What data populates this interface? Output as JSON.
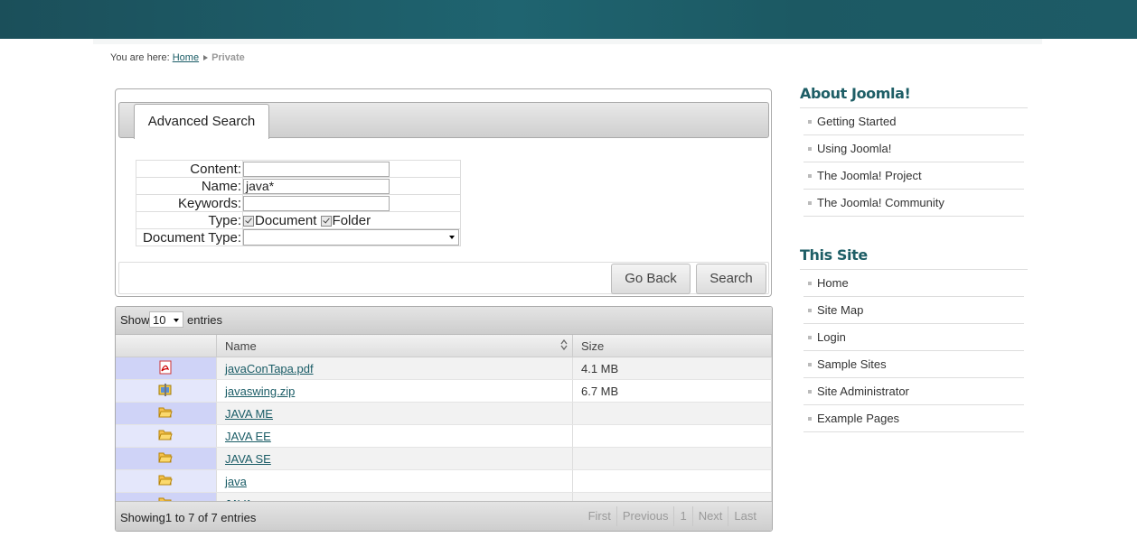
{
  "breadcrumb": {
    "prefix": "You are here:",
    "home": "Home",
    "current": "Private"
  },
  "search": {
    "tab_label": "Advanced Search",
    "content_label": "Content:",
    "content_value": "",
    "name_label": "Name:",
    "name_value": "java*",
    "keywords_label": "Keywords:",
    "keywords_value": "",
    "type_label": "Type:",
    "type_document": "Document",
    "type_folder": "Folder",
    "doctype_label": "Document Type:",
    "doctype_value": "",
    "go_back": "Go Back",
    "search_btn": "Search"
  },
  "results": {
    "show_label": "Show",
    "page_length": "10",
    "entries_label": "entries",
    "columns": [
      "",
      "Name",
      "Size"
    ],
    "rows": [
      {
        "icon": "pdf-icon",
        "name": "javaConTapa.pdf",
        "size": "4.1 MB"
      },
      {
        "icon": "zip-icon",
        "name": "javaswing.zip",
        "size": "6.7 MB"
      },
      {
        "icon": "folder-icon",
        "name": "JAVA ME",
        "size": ""
      },
      {
        "icon": "folder-icon",
        "name": "JAVA EE",
        "size": ""
      },
      {
        "icon": "folder-icon",
        "name": "JAVA SE",
        "size": ""
      },
      {
        "icon": "folder-icon",
        "name": "java",
        "size": ""
      },
      {
        "icon": "folder-icon",
        "name": "JAVA",
        "size": ""
      }
    ],
    "info": "Showing1 to 7 of 7 entries",
    "pager": {
      "first": "First",
      "previous": "Previous",
      "page": "1",
      "next": "Next",
      "last": "Last"
    }
  },
  "sidebar": {
    "about_title": "About Joomla!",
    "about_items": [
      "Getting Started",
      "Using Joomla!",
      "The Joomla! Project",
      "The Joomla! Community"
    ],
    "site_title": "This Site",
    "site_items": [
      "Home",
      "Site Map",
      "Login",
      "Sample Sites",
      "Site Administrator",
      "Example Pages"
    ]
  },
  "colors": {
    "header": "#1f6470",
    "accent": "#1e5e66",
    "row_icon_odd": "#cfd3f7"
  }
}
